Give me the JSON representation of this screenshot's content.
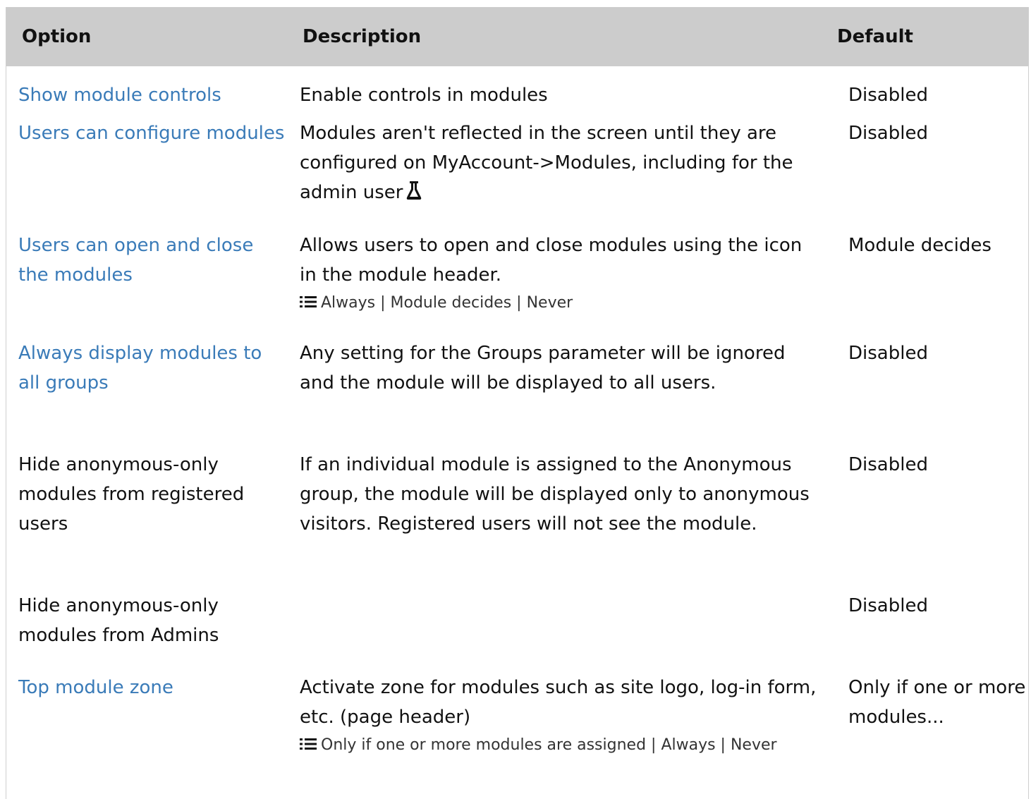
{
  "header": {
    "option": "Option",
    "description": "Description",
    "default": "Default"
  },
  "rows": [
    {
      "option": "Show module controls",
      "option_is_link": true,
      "description": "Enable controls in modules",
      "default": "Disabled"
    },
    {
      "option": "Users can configure modules",
      "option_is_link": true,
      "description": "Modules aren't reflected in the screen until they are configured on MyAccount->Modules, including for the admin user",
      "description_icon": "flask-icon",
      "default": "Disabled"
    },
    {
      "option": "Users can open and close the modules",
      "option_is_link": true,
      "description": "Allows users to open and close modules using the icon in the module header.",
      "hint_icon": "list-icon",
      "hint": "Always | Module decides | Never",
      "default": "Module decides"
    },
    {
      "option": "Always display modules to all groups",
      "option_is_link": true,
      "description": "Any setting for the Groups parameter will be ignored and the module will be displayed to all users.",
      "default": "Disabled"
    },
    {
      "option": "Hide anonymous-only modules from registered users",
      "option_is_link": false,
      "description": "If an individual module is assigned to the Anonymous group, the module will be displayed only to anonymous visitors. Registered users will not see the module.",
      "default": "Disabled"
    },
    {
      "option": "Hide anonymous-only modules from Admins",
      "option_is_link": false,
      "description": "",
      "default": "Disabled"
    },
    {
      "option": "Top module zone",
      "option_is_link": true,
      "description": "Activate zone for modules such as site logo, log-in form, etc. (page header)",
      "hint_icon": "list-icon",
      "hint": "Only if one or more modules are assigned | Always | Never",
      "default": "Only if one or more modules..."
    }
  ],
  "colors": {
    "header_bg": "#cccccc",
    "link": "#3a7bb8",
    "text": "#111111"
  }
}
